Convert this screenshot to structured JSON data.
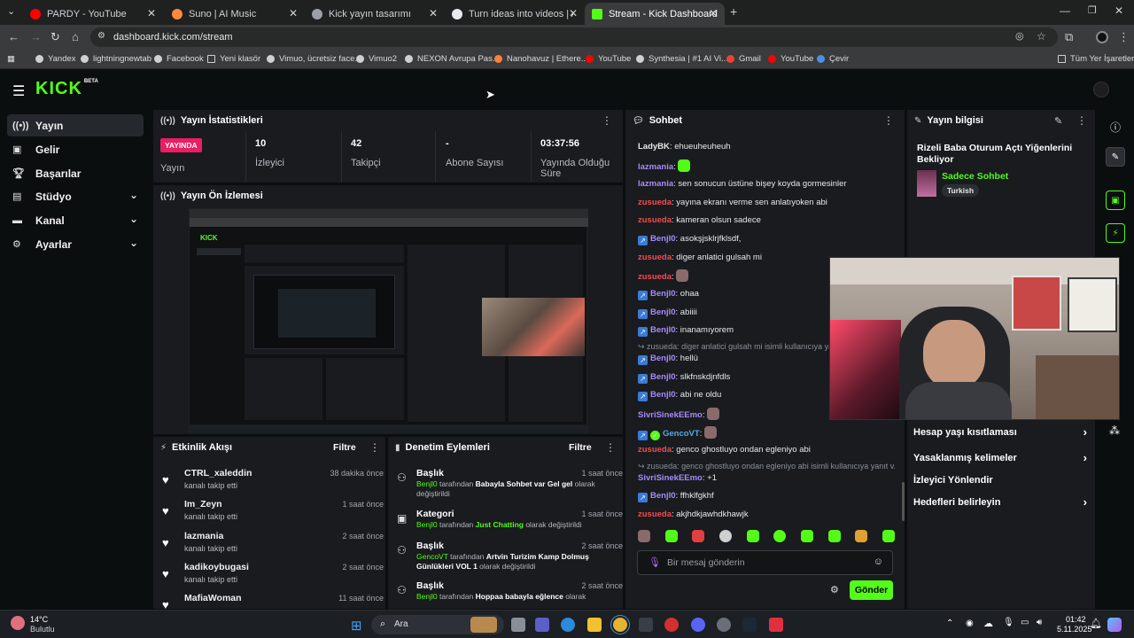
{
  "browser": {
    "tabs": [
      {
        "title": "PARDY - YouTube",
        "color": "#ff0000"
      },
      {
        "title": "Suno | AI Music",
        "color": "#ff8a3d"
      },
      {
        "title": "Kick yayın tasarımı",
        "color": "#9aa0a6"
      },
      {
        "title": "Turn ideas into videos | AI vide",
        "color": "#e8eaed"
      },
      {
        "title": "Stream - Kick Dashboard",
        "color": "#53fc18"
      }
    ],
    "url": "dashboard.kick.com/stream",
    "bookmarks": [
      "Yandex",
      "lightningnewtab",
      "Facebook",
      "Yeni klasör",
      "Vimuo, ücretsiz face...",
      "Vimuo2",
      "NEXON Avrupa Pas...",
      "Nanohavuz | Ethere...",
      "YouTube",
      "Synthesia | #1 AI Vi...",
      "Gmail",
      "YouTube",
      "Çevir"
    ],
    "all_bookmarks": "Tüm Yer İşaretleri"
  },
  "brand": {
    "logo": "KICK",
    "beta": "BETA",
    "accent": "#53fc18"
  },
  "sidebar": {
    "items": [
      {
        "label": "Yayın",
        "icon": "broadcast-icon"
      },
      {
        "label": "Gelir",
        "icon": "money-icon"
      },
      {
        "label": "Başarılar",
        "icon": "trophy-icon"
      },
      {
        "label": "Stüdyo",
        "icon": "studio-icon"
      },
      {
        "label": "Kanal",
        "icon": "channel-icon"
      },
      {
        "label": "Ayarlar",
        "icon": "gear-icon"
      }
    ]
  },
  "stats": {
    "title": "Yayın İstatistikleri",
    "live_badge": "YAYINDA",
    "live_label": "Yayın",
    "viewers_value": "10",
    "viewers_label": "İzleyici",
    "followers_value": "42",
    "followers_label": "Takipçi",
    "subs_value": "-",
    "subs_label": "Abone Sayısı",
    "uptime_value": "03:37:56",
    "uptime_label": "Yayında Olduğu Süre"
  },
  "preview": {
    "title": "Yayın Ön İzlemesi"
  },
  "activity": {
    "title": "Etkinlik Akışı",
    "filter": "Filtre",
    "items": [
      {
        "name": "CTRL_xaleddin",
        "action": "kanalı takip etti",
        "time": "38 dakika önce"
      },
      {
        "name": "Im_Zeyn",
        "action": "kanalı takip etti",
        "time": "1 saat önce"
      },
      {
        "name": "lazmania",
        "action": "kanalı takip etti",
        "time": "2 saat önce"
      },
      {
        "name": "kadikoybugasi",
        "action": "kanalı takip etti",
        "time": "2 saat önce"
      },
      {
        "name": "MafiaWoman",
        "action": "",
        "time": "11 saat önce"
      }
    ]
  },
  "moderation": {
    "title": "Denetim Eylemleri",
    "filter": "Filtre",
    "items": [
      {
        "type": "Başlık",
        "time": "1 saat önce",
        "user": "Benjl0",
        "mid": " tarafından ",
        "value": "Babayla Sohbet var Gel gel",
        "tail": " olarak değiştirildi"
      },
      {
        "type": "Kategori",
        "time": "1 saat önce",
        "user": "Benjl0",
        "mid": " tarafından ",
        "value": "Just Chatting",
        "tail": " olarak değiştirildi"
      },
      {
        "type": "Başlık",
        "time": "2 saat önce",
        "user": "GencoVT",
        "mid": " tarafından ",
        "value": "Artvin Turizim Kamp Dolmuş Günlükleri VOL 1",
        "tail": " olarak değiştirildi"
      },
      {
        "type": "Başlık",
        "time": "2 saat önce",
        "user": "Benjl0",
        "mid": " tarafından ",
        "value": "Hoppaa babayla eğlence",
        "tail": " olarak"
      }
    ]
  },
  "chat": {
    "title": "Sohbet",
    "messages": [
      {
        "user": "LadyBK",
        "color": "#e8e8e8",
        "text": "ehueuheuheuh"
      },
      {
        "user": "lazmania",
        "color": "#a78bfa",
        "text": ""
      },
      {
        "user": "lazmania",
        "color": "#a78bfa",
        "text": "sen sonucun üstüne bişey koyda gormesinler"
      },
      {
        "user": "zusueda",
        "color": "#f24e4e",
        "text": "yayına ekranı verme sen anlatıyoken abi"
      },
      {
        "user": "zusueda",
        "color": "#f24e4e",
        "text": "kameran olsun sadece"
      },
      {
        "user": "Benjl0",
        "color": "#a78bfa",
        "text": "asokşjsklrjfklsdf,"
      },
      {
        "user": "zusueda",
        "color": "#f24e4e",
        "text": "diger anlatici gulsah mi"
      },
      {
        "user": "zusueda",
        "color": "#f24e4e",
        "text": ""
      },
      {
        "user": "Benjl0",
        "color": "#a78bfa",
        "text": "ohaa"
      },
      {
        "user": "Benjl0",
        "color": "#a78bfa",
        "text": "abiiii"
      },
      {
        "user": "Benjl0",
        "color": "#a78bfa",
        "text": "inanamıyorem"
      },
      {
        "user": "Benjl0",
        "color": "#a78bfa",
        "text": "hellü"
      },
      {
        "user": "Benjl0",
        "color": "#a78bfa",
        "text": "slkfnskdjnfdls"
      },
      {
        "user": "Benjl0",
        "color": "#a78bfa",
        "text": "abi ne oldu"
      },
      {
        "user": "SivriSinekEEmo",
        "color": "#a78bfa",
        "text": ""
      },
      {
        "user": "GencoVT",
        "color": "#5aa9e6",
        "text": ""
      },
      {
        "user": "zusueda",
        "color": "#f24e4e",
        "text": "genco ghostluyo ondan egleniyo abi"
      },
      {
        "user": "SivriSinekEEmo",
        "color": "#a78bfa",
        "text": "+1"
      },
      {
        "user": "Benjl0",
        "color": "#a78bfa",
        "text": "ffhklfgkhf"
      },
      {
        "user": "zusueda",
        "color": "#f24e4e",
        "text": "akjhdkjawhdkhawjk"
      }
    ],
    "reply1": "zusueda: diger anlatici gulsah mi isimli kullanıcıya yanıt",
    "reply2": "zusueda: genco ghostluyo ondan egleniyo abi isimli kullanıcıya yanıt v...",
    "placeholder": "Bir mesaj gönderin",
    "send": "Gönder"
  },
  "stream_info": {
    "title": "Yayın bilgisi",
    "stream_title": "Rizeli Baba Oturum Açtı Yiğenlerini Bekliyor",
    "category": "Sadece Sohbet",
    "language": "Turkish",
    "options": [
      "Hesap yaşı kısıtlaması",
      "Yasaklanmış kelimeler",
      "İzleyici Yönlendir",
      "Hedefleri belirleyin"
    ]
  },
  "taskbar": {
    "weather_temp": "14°C",
    "weather_desc": "Bulutlu",
    "search": "Ara",
    "time": "01:42",
    "date": "5.11.2025"
  }
}
